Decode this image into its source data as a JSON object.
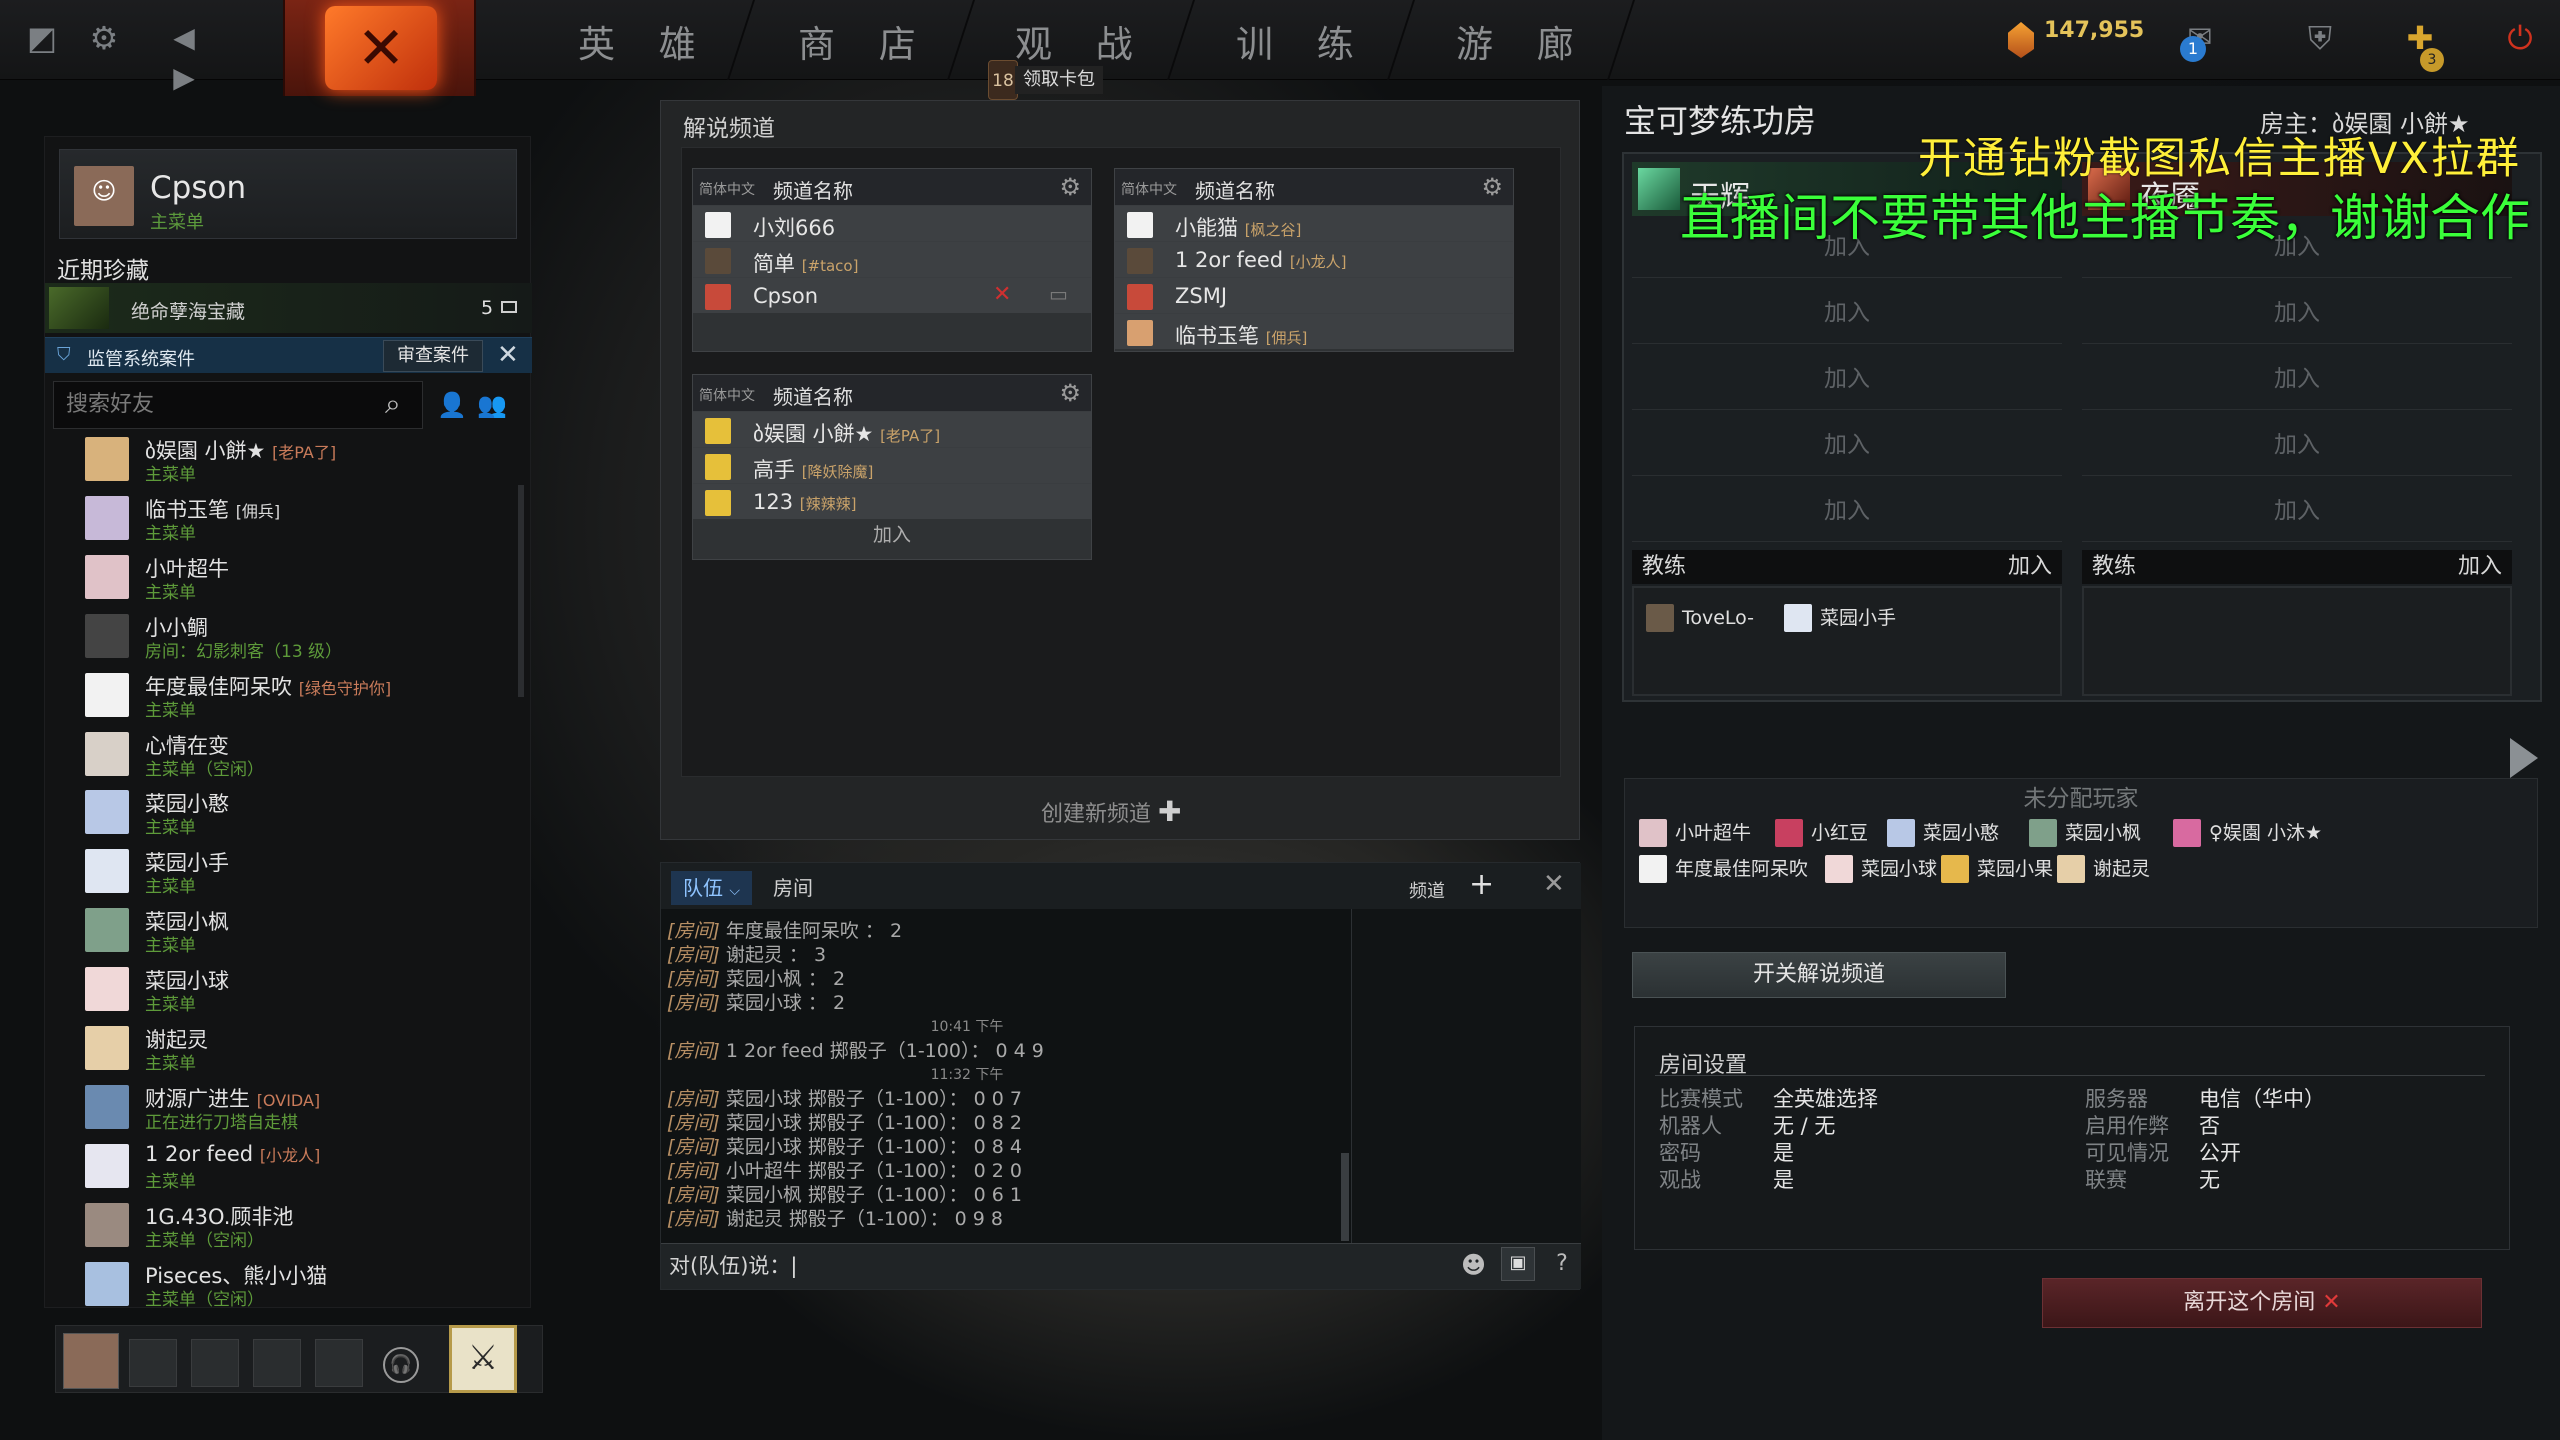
{
  "nav": {
    "items": [
      "英 雄",
      "商 店",
      "观 战",
      "训 练",
      "游 廊"
    ],
    "badge_count": "18",
    "card_pack_label": "领取卡包",
    "gold": "147,955",
    "mail_count": "1",
    "plus_count": "3"
  },
  "profile": {
    "name": "Cpson",
    "status": "主菜单"
  },
  "recent": {
    "title": "近期珍藏",
    "treasure_name": "绝命孽海宝藏",
    "treasure_count": "5",
    "audit_label": "监管系统案件",
    "audit_button": "审查案件"
  },
  "search": {
    "placeholder": "搜索好友"
  },
  "friends": [
    {
      "name": "ბ娱園 小餅★",
      "tag": "[老PA了]",
      "status": "主菜单",
      "color": "#d8b27c"
    },
    {
      "name": "临书玉笔",
      "tag": "[佣兵]",
      "status": "主菜单",
      "color": "#c7b9d8"
    },
    {
      "name": "小叶超牛",
      "tag": "",
      "status": "主菜单",
      "color": "#e0c2c8"
    },
    {
      "name": "小小鲷",
      "tag": "",
      "status": "房间：幻影刺客（13 级）",
      "color": "#444"
    },
    {
      "name": "年度最佳阿呆吹",
      "tag": "[绿色守护你]",
      "status": "主菜单",
      "color": "#f2f2f2"
    },
    {
      "name": "心情在变",
      "tag": "",
      "status": "主菜单（空闲）",
      "color": "#d8d0c8"
    },
    {
      "name": "菜园小憨",
      "tag": "",
      "status": "主菜单",
      "color": "#b8c8e6"
    },
    {
      "name": "菜园小手",
      "tag": "",
      "status": "主菜单",
      "color": "#dfe6f2"
    },
    {
      "name": "菜园小枫",
      "tag": "",
      "status": "主菜单",
      "color": "#7fa08a"
    },
    {
      "name": "菜园小球",
      "tag": "",
      "status": "主菜单",
      "color": "#f0d8d8"
    },
    {
      "name": "谢起灵",
      "tag": "",
      "status": "主菜单",
      "color": "#e6cfa8"
    },
    {
      "name": "财源广进生",
      "tag": "[OVIDA]",
      "status": "正在进行刀塔自走棋",
      "color": "#6a8ab0"
    },
    {
      "name": "1 2or feed",
      "tag": "[小龙人]",
      "status": "主菜单",
      "color": "#e6e6f0"
    },
    {
      "name": "1G.43O.顾非池",
      "tag": "",
      "status": "主菜单（空闲）",
      "color": "#9a8a80"
    },
    {
      "name": "Piseces、熊小小猫",
      "tag": "",
      "status": "主菜单（空闲）",
      "color": "#a8c0e0"
    }
  ],
  "channels": {
    "panel_title": "解说频道",
    "lang": "简体中文",
    "name_label": "频道名称",
    "join": "加入",
    "create": "创建新频道",
    "list": [
      {
        "members": [
          {
            "name": "小刘666",
            "tag": ""
          },
          {
            "name": "简单",
            "tag": "[#taco]"
          },
          {
            "name": "Cpson",
            "tag": ""
          }
        ]
      },
      {
        "members": [
          {
            "name": "小能猫",
            "tag": "[枫之谷]"
          },
          {
            "name": "1 2or feed",
            "tag": "[小龙人]"
          },
          {
            "name": "ZSMJ",
            "tag": ""
          },
          {
            "name": "临书玉笔",
            "tag": "[佣兵]"
          }
        ]
      },
      {
        "members": [
          {
            "name": "ბ娱園 小餅★",
            "tag": "[老PA了]"
          },
          {
            "name": "高手",
            "tag": "[降妖除魔]"
          },
          {
            "name": "123",
            "tag": "[辣辣辣]"
          }
        ]
      }
    ]
  },
  "chat": {
    "tab_team": "队伍",
    "tab_room": "房间",
    "channel_label": "频道",
    "input_prefix": "对(队伍)说：",
    "lines": [
      {
        "type": "msg",
        "prefix": "[房间]",
        "text": "年度最佳阿呆吹 ： 2"
      },
      {
        "type": "msg",
        "prefix": "[房间]",
        "text": "谢起灵 ： 3"
      },
      {
        "type": "msg",
        "prefix": "[房间]",
        "text": "菜园小枫 ： 2"
      },
      {
        "type": "msg",
        "prefix": "[房间]",
        "text": "菜园小球 ： 2"
      },
      {
        "type": "time",
        "text": "10:41 下午"
      },
      {
        "type": "msg",
        "prefix": "[房间]",
        "text": "1 2or feed 掷骰子（1-100）： 0 4 9"
      },
      {
        "type": "time",
        "text": "11:32 下午"
      },
      {
        "type": "msg",
        "prefix": "[房间]",
        "text": "菜园小球 掷骰子（1-100）： 0 0 7"
      },
      {
        "type": "msg",
        "prefix": "[房间]",
        "text": "菜园小球 掷骰子（1-100）： 0 8 2"
      },
      {
        "type": "msg",
        "prefix": "[房间]",
        "text": "菜园小球 掷骰子（1-100）： 0 8 4"
      },
      {
        "type": "msg",
        "prefix": "[房间]",
        "text": "小叶超牛 掷骰子（1-100）： 0 2 0"
      },
      {
        "type": "msg",
        "prefix": "[房间]",
        "text": "菜园小枫 掷骰子（1-100）： 0 6 1"
      },
      {
        "type": "msg",
        "prefix": "[房间]",
        "text": "谢起灵 掷骰子（1-100）： 0 9 8"
      }
    ]
  },
  "lobby": {
    "title": "宝可梦练功房",
    "host_label": "房主：",
    "host_name": "ბ娱園 小餅★",
    "radiant": "天辉",
    "dire": "夜魇",
    "join": "加入",
    "coach": "教练",
    "radiant_coaches": [
      "ToveLo-",
      "菜园小手"
    ],
    "unassigned_title": "未分配玩家",
    "unassigned": [
      {
        "name": "小叶超牛",
        "color": "#e0c2c8"
      },
      {
        "name": "小红豆",
        "color": "#c84060"
      },
      {
        "name": "菜园小憨",
        "color": "#b8c8e6"
      },
      {
        "name": "菜园小枫",
        "color": "#7fa08a"
      },
      {
        "name": "♀娱園 小沐★",
        "color": "#d86aa0"
      },
      {
        "name": "年度最佳阿呆吹",
        "color": "#f2f2f2"
      },
      {
        "name": "菜园小球",
        "color": "#f0d8d8"
      },
      {
        "name": "菜园小果",
        "color": "#e6b84c"
      },
      {
        "name": "谢起灵",
        "color": "#e6cfa8"
      }
    ],
    "toggle_button": "开关解说频道",
    "settings_title": "房间设置",
    "settings_left": [
      {
        "k": "比赛模式",
        "v": "全英雄选择"
      },
      {
        "k": "机器人",
        "v": "无 / 无"
      },
      {
        "k": "密码",
        "v": "是"
      },
      {
        "k": "观战",
        "v": "是"
      }
    ],
    "settings_right": [
      {
        "k": "服务器",
        "v": "电信（华中）"
      },
      {
        "k": "启用作弊",
        "v": "否"
      },
      {
        "k": "可见情况",
        "v": "公开"
      },
      {
        "k": "联赛",
        "v": "无"
      }
    ],
    "leave_button": "离开这个房间"
  },
  "overlay": {
    "line1": "开通钻粉截图私信主播VX拉群",
    "line2": "直播间不要带其他主播节奏，谢谢合作"
  }
}
